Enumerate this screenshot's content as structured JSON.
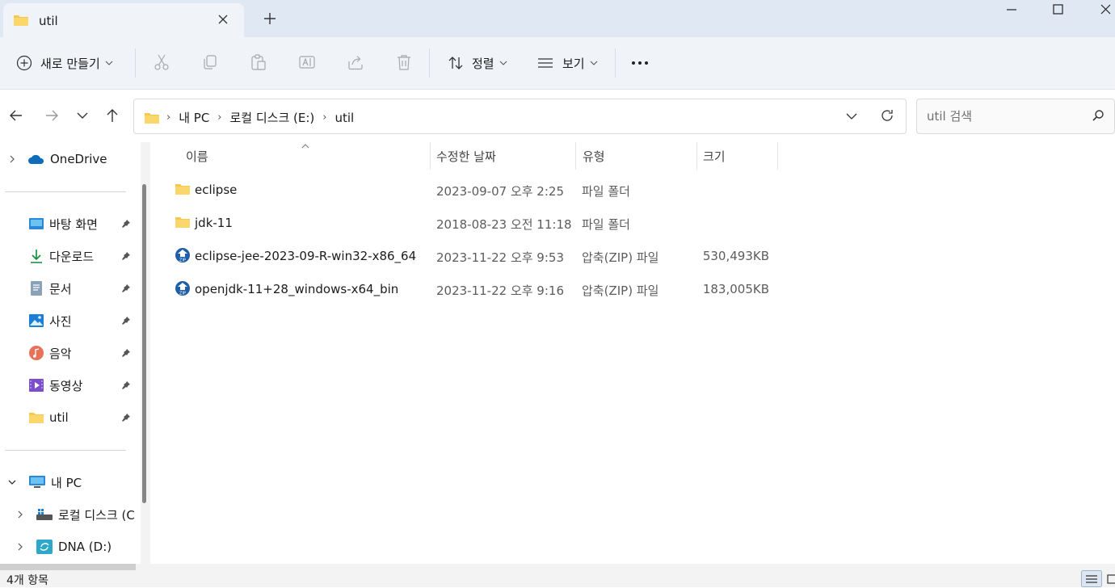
{
  "tab": {
    "title": "util"
  },
  "toolbar": {
    "new_label": "새로 만들기",
    "sort_label": "정렬",
    "view_label": "보기"
  },
  "address": {
    "crumbs": [
      "내 PC",
      "로컬 디스크 (E:)",
      "util"
    ]
  },
  "search": {
    "placeholder": "util 검색"
  },
  "sidebar": {
    "onedrive": "OneDrive",
    "quick": [
      "바탕 화면",
      "다운로드",
      "문서",
      "사진",
      "음악",
      "동영상",
      "util"
    ],
    "thispc": "내 PC",
    "drives": [
      "로컬 디스크 (C",
      "DNA (D:)"
    ]
  },
  "columns": {
    "name": "이름",
    "date": "수정한 날짜",
    "type": "유형",
    "size": "크기"
  },
  "files": [
    {
      "name": "eclipse",
      "date": "2023-09-07 오후 2:25",
      "type": "파일 폴더",
      "size": "",
      "icon": "folder-icon"
    },
    {
      "name": "jdk-11",
      "date": "2018-08-23 오전 11:18",
      "type": "파일 폴더",
      "size": "",
      "icon": "folder-icon"
    },
    {
      "name": "eclipse-jee-2023-09-R-win32-x86_64",
      "date": "2023-11-22 오후 9:53",
      "type": "압축(ZIP) 파일",
      "size": "530,493KB",
      "icon": "zip-icon"
    },
    {
      "name": "openjdk-11+28_windows-x64_bin",
      "date": "2023-11-22 오후 9:16",
      "type": "압축(ZIP) 파일",
      "size": "183,005KB",
      "icon": "zip-icon"
    }
  ],
  "status": {
    "count": "4개 항목"
  },
  "colors": {
    "titlebar": "#dfe8f3",
    "toolbar": "#f0f4f9",
    "folder": "#f8c74e",
    "accent": "#0067c0"
  }
}
